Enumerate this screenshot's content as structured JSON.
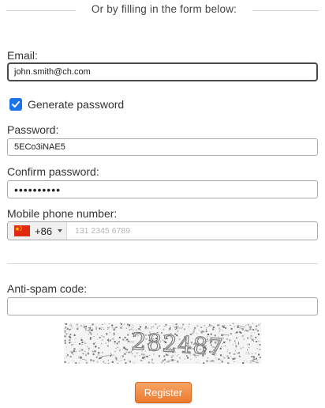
{
  "header": {
    "divider_text": "Or by filling in the form below:"
  },
  "email": {
    "label": "Email:",
    "value": "john.smith@ch.com"
  },
  "generate_password": {
    "label": "Generate password",
    "checked": true
  },
  "password": {
    "label": "Password:",
    "value": "5ECo3iNAE5"
  },
  "confirm_password": {
    "label": "Confirm password:",
    "masked_value": "••••••••••"
  },
  "mobile": {
    "label": "Mobile phone number:",
    "country_flag": "china-flag-icon",
    "dial_code": "+86",
    "placeholder": "131 2345 6789"
  },
  "anti_spam": {
    "label": "Anti-spam code:",
    "value": "",
    "captcha_text": "282487"
  },
  "actions": {
    "register_label": "Register"
  },
  "colors": {
    "checkbox": "#1a73e8",
    "register_button": "#ee7a2c",
    "flag_red": "#de2910",
    "flag_yellow": "#ffde00"
  }
}
